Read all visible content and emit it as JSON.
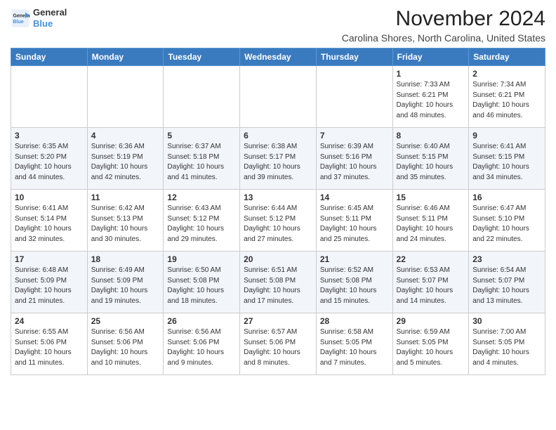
{
  "header": {
    "logo_line1": "General",
    "logo_line2": "Blue",
    "month": "November 2024",
    "location": "Carolina Shores, North Carolina, United States"
  },
  "weekdays": [
    "Sunday",
    "Monday",
    "Tuesday",
    "Wednesday",
    "Thursday",
    "Friday",
    "Saturday"
  ],
  "weeks": [
    [
      {
        "day": "",
        "info": ""
      },
      {
        "day": "",
        "info": ""
      },
      {
        "day": "",
        "info": ""
      },
      {
        "day": "",
        "info": ""
      },
      {
        "day": "",
        "info": ""
      },
      {
        "day": "1",
        "info": "Sunrise: 7:33 AM\nSunset: 6:21 PM\nDaylight: 10 hours\nand 48 minutes."
      },
      {
        "day": "2",
        "info": "Sunrise: 7:34 AM\nSunset: 6:21 PM\nDaylight: 10 hours\nand 46 minutes."
      }
    ],
    [
      {
        "day": "3",
        "info": "Sunrise: 6:35 AM\nSunset: 5:20 PM\nDaylight: 10 hours\nand 44 minutes."
      },
      {
        "day": "4",
        "info": "Sunrise: 6:36 AM\nSunset: 5:19 PM\nDaylight: 10 hours\nand 42 minutes."
      },
      {
        "day": "5",
        "info": "Sunrise: 6:37 AM\nSunset: 5:18 PM\nDaylight: 10 hours\nand 41 minutes."
      },
      {
        "day": "6",
        "info": "Sunrise: 6:38 AM\nSunset: 5:17 PM\nDaylight: 10 hours\nand 39 minutes."
      },
      {
        "day": "7",
        "info": "Sunrise: 6:39 AM\nSunset: 5:16 PM\nDaylight: 10 hours\nand 37 minutes."
      },
      {
        "day": "8",
        "info": "Sunrise: 6:40 AM\nSunset: 5:15 PM\nDaylight: 10 hours\nand 35 minutes."
      },
      {
        "day": "9",
        "info": "Sunrise: 6:41 AM\nSunset: 5:15 PM\nDaylight: 10 hours\nand 34 minutes."
      }
    ],
    [
      {
        "day": "10",
        "info": "Sunrise: 6:41 AM\nSunset: 5:14 PM\nDaylight: 10 hours\nand 32 minutes."
      },
      {
        "day": "11",
        "info": "Sunrise: 6:42 AM\nSunset: 5:13 PM\nDaylight: 10 hours\nand 30 minutes."
      },
      {
        "day": "12",
        "info": "Sunrise: 6:43 AM\nSunset: 5:12 PM\nDaylight: 10 hours\nand 29 minutes."
      },
      {
        "day": "13",
        "info": "Sunrise: 6:44 AM\nSunset: 5:12 PM\nDaylight: 10 hours\nand 27 minutes."
      },
      {
        "day": "14",
        "info": "Sunrise: 6:45 AM\nSunset: 5:11 PM\nDaylight: 10 hours\nand 25 minutes."
      },
      {
        "day": "15",
        "info": "Sunrise: 6:46 AM\nSunset: 5:11 PM\nDaylight: 10 hours\nand 24 minutes."
      },
      {
        "day": "16",
        "info": "Sunrise: 6:47 AM\nSunset: 5:10 PM\nDaylight: 10 hours\nand 22 minutes."
      }
    ],
    [
      {
        "day": "17",
        "info": "Sunrise: 6:48 AM\nSunset: 5:09 PM\nDaylight: 10 hours\nand 21 minutes."
      },
      {
        "day": "18",
        "info": "Sunrise: 6:49 AM\nSunset: 5:09 PM\nDaylight: 10 hours\nand 19 minutes."
      },
      {
        "day": "19",
        "info": "Sunrise: 6:50 AM\nSunset: 5:08 PM\nDaylight: 10 hours\nand 18 minutes."
      },
      {
        "day": "20",
        "info": "Sunrise: 6:51 AM\nSunset: 5:08 PM\nDaylight: 10 hours\nand 17 minutes."
      },
      {
        "day": "21",
        "info": "Sunrise: 6:52 AM\nSunset: 5:08 PM\nDaylight: 10 hours\nand 15 minutes."
      },
      {
        "day": "22",
        "info": "Sunrise: 6:53 AM\nSunset: 5:07 PM\nDaylight: 10 hours\nand 14 minutes."
      },
      {
        "day": "23",
        "info": "Sunrise: 6:54 AM\nSunset: 5:07 PM\nDaylight: 10 hours\nand 13 minutes."
      }
    ],
    [
      {
        "day": "24",
        "info": "Sunrise: 6:55 AM\nSunset: 5:06 PM\nDaylight: 10 hours\nand 11 minutes."
      },
      {
        "day": "25",
        "info": "Sunrise: 6:56 AM\nSunset: 5:06 PM\nDaylight: 10 hours\nand 10 minutes."
      },
      {
        "day": "26",
        "info": "Sunrise: 6:56 AM\nSunset: 5:06 PM\nDaylight: 10 hours\nand 9 minutes."
      },
      {
        "day": "27",
        "info": "Sunrise: 6:57 AM\nSunset: 5:06 PM\nDaylight: 10 hours\nand 8 minutes."
      },
      {
        "day": "28",
        "info": "Sunrise: 6:58 AM\nSunset: 5:05 PM\nDaylight: 10 hours\nand 7 minutes."
      },
      {
        "day": "29",
        "info": "Sunrise: 6:59 AM\nSunset: 5:05 PM\nDaylight: 10 hours\nand 5 minutes."
      },
      {
        "day": "30",
        "info": "Sunrise: 7:00 AM\nSunset: 5:05 PM\nDaylight: 10 hours\nand 4 minutes."
      }
    ]
  ]
}
